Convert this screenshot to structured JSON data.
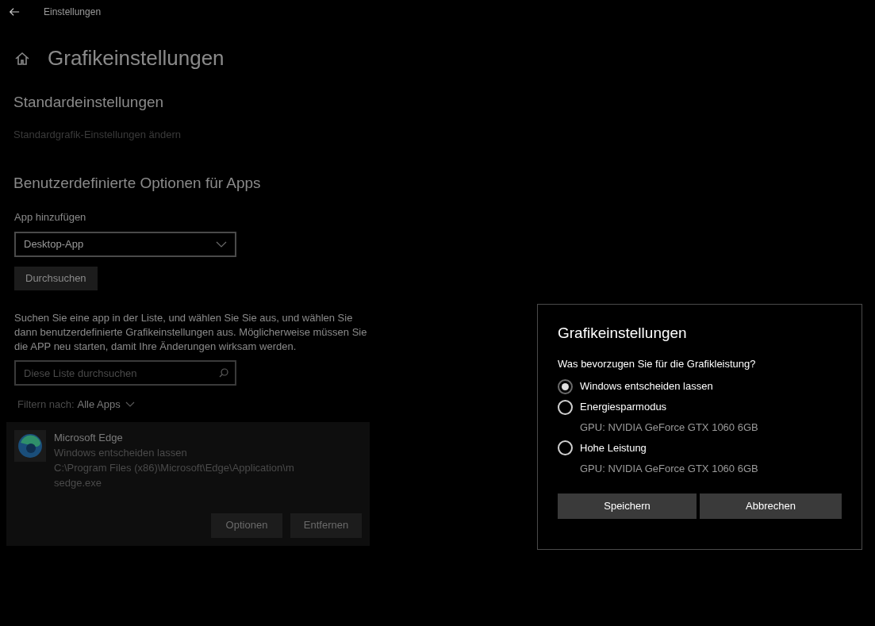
{
  "window": {
    "title": "Einstellungen"
  },
  "page": {
    "title": "Grafikeinstellungen"
  },
  "default_section": {
    "heading": "Standardeinstellungen",
    "link": "Standardgrafik-Einstellungen ändern",
    "link_disabled": true
  },
  "custom_section": {
    "heading": "Benutzerdefinierte Optionen für Apps",
    "add_label": "App hinzufügen",
    "app_type": "Desktop-App",
    "browse_button": "Durchsuchen",
    "description": "Suchen Sie eine app in der Liste, und wählen Sie Sie aus, und wählen Sie dann benutzerdefinierte Grafikeinstellungen aus. Möglicherweise müssen Sie die APP neu starten, damit Ihre Änderungen wirksam werden.",
    "search": {
      "placeholder": "Diese Liste durchsuchen"
    },
    "filter_label": "Filtern nach:",
    "filter_value": "Alle Apps"
  },
  "apps": [
    {
      "name": "Microsoft Edge",
      "preference": "Windows entscheiden lassen",
      "path": "C:\\Program Files (x86)\\Microsoft\\Edge\\Application\\msedge.exe",
      "selected": true,
      "buttons": [
        "Optionen",
        "Entfernen"
      ]
    }
  ],
  "dialog": {
    "title": "Grafikeinstellungen",
    "question": "Was bevorzugen Sie für die Grafikleistung?",
    "options": [
      {
        "label": "Windows entscheiden lassen",
        "selected": true
      },
      {
        "label": "Energiesparmodus",
        "detail": "GPU: NVIDIA GeForce GTX 1060 6GB",
        "selected": false
      },
      {
        "label": "Hohe Leistung",
        "detail": "GPU: NVIDIA GeForce GTX 1060 6GB",
        "selected": false
      }
    ],
    "buttons": [
      "Speichern",
      "Abbrechen"
    ]
  }
}
